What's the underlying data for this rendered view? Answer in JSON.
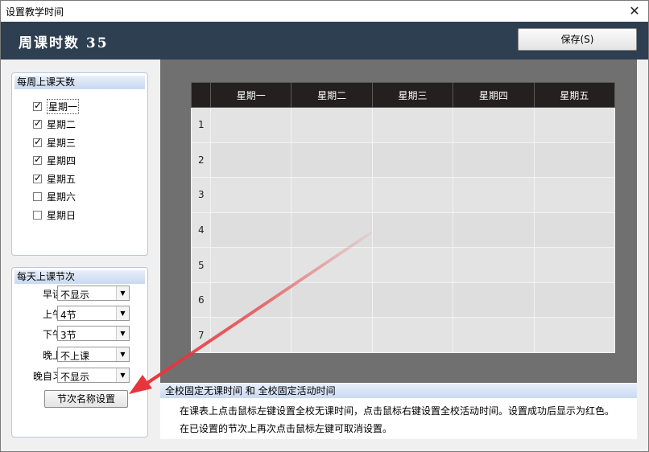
{
  "window": {
    "title": "设置教学时间",
    "close_glyph": "✕"
  },
  "header": {
    "week_hours_label": "周课时数",
    "week_hours_value": "35",
    "save_label": "保存(S)"
  },
  "days_group": {
    "title": "每周上课天数",
    "days": [
      {
        "label": "星期一",
        "checked": true
      },
      {
        "label": "星期二",
        "checked": true
      },
      {
        "label": "星期三",
        "checked": true
      },
      {
        "label": "星期四",
        "checked": true
      },
      {
        "label": "星期五",
        "checked": true
      },
      {
        "label": "星期六",
        "checked": false
      },
      {
        "label": "星期日",
        "checked": false
      }
    ]
  },
  "periods_group": {
    "title": "每天上课节次",
    "rows": [
      {
        "label": "早读",
        "value": "不显示"
      },
      {
        "label": "上午",
        "value": "4节"
      },
      {
        "label": "下午",
        "value": "3节"
      },
      {
        "label": "晚上",
        "value": "不上课"
      },
      {
        "label": "晚自习",
        "value": "不显示"
      }
    ],
    "names_button_label": "节次名称设置"
  },
  "timetable": {
    "columns": [
      "星期一",
      "星期二",
      "星期三",
      "星期四",
      "星期五"
    ],
    "rows": [
      "1",
      "2",
      "3",
      "4",
      "5",
      "6",
      "7"
    ]
  },
  "info": {
    "title": "全校固定无课时间 和 全校固定活动时间",
    "line1": "在课表上点击鼠标左键设置全校无课时间，点击鼠标右键设置全校活动时间。设置成功后显示为红色。",
    "line2": "在已设置的节次上再次点击鼠标左键可取消设置。"
  },
  "colors": {
    "header_bg": "#2f3f52",
    "grid_bg": "#707070",
    "table_header_bg": "#24201f",
    "annotation_arrow": "#e8353b"
  }
}
